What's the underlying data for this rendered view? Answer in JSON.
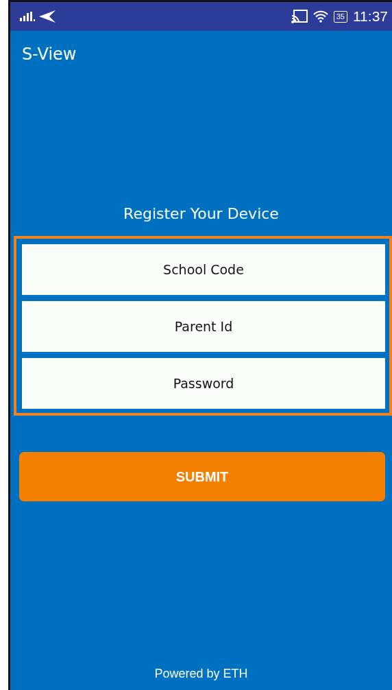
{
  "status_bar": {
    "battery": "35",
    "time": "11:37"
  },
  "app_bar": {
    "title": "S-View"
  },
  "form": {
    "heading": "Register Your Device",
    "fields": [
      {
        "placeholder": "School Code"
      },
      {
        "placeholder": "Parent Id"
      },
      {
        "placeholder": "Password"
      }
    ],
    "submit": "SUBMIT"
  },
  "footer": "Powered by ETH"
}
